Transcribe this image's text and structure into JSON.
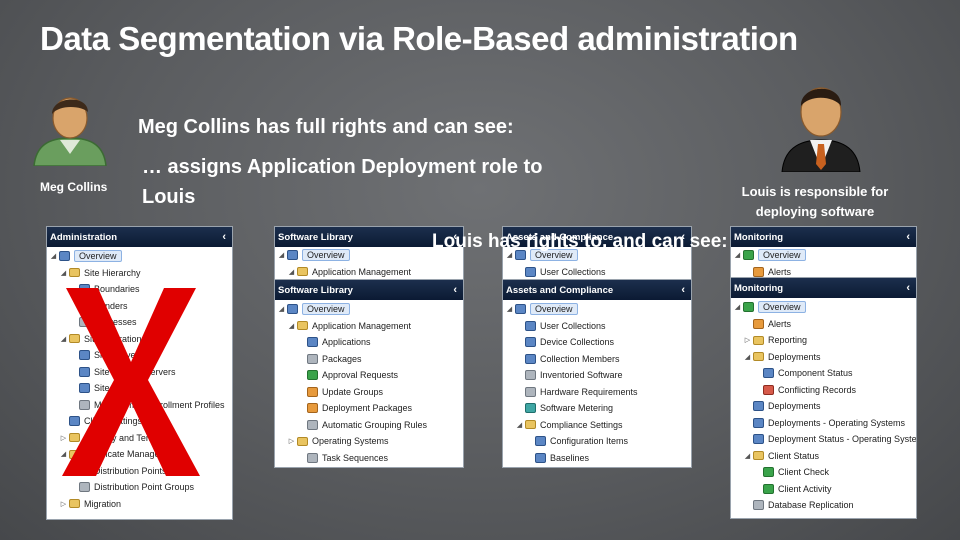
{
  "title": "Data Segmentation via Role-Based administration",
  "meg": {
    "caption": "Meg Collins",
    "line1": "Meg Collins has full rights and can see:",
    "line2": "… assigns Application Deployment role to Louis"
  },
  "louis": {
    "caption": "Louis is responsible for deploying software",
    "line3": "Louis has rights to, and can see:"
  },
  "colors": {
    "panel_header": "#0b1a33",
    "x_mark": "#e00000"
  },
  "admin_panel": {
    "header": "Administration",
    "items": [
      {
        "label": "Overview",
        "icon": "blue",
        "exp": "◢"
      },
      {
        "label": "Site Hierarchy",
        "icon": "folder",
        "exp": "◢"
      },
      {
        "label": "Boundaries",
        "icon": "blue",
        "exp": ""
      },
      {
        "label": "Senders",
        "icon": "gray",
        "exp": ""
      },
      {
        "label": "Addresses",
        "icon": "gray",
        "exp": ""
      },
      {
        "label": "Site Operations",
        "icon": "folder",
        "exp": "◢"
      },
      {
        "label": "Site Servers",
        "icon": "blue",
        "exp": ""
      },
      {
        "label": "Site System Servers",
        "icon": "blue",
        "exp": ""
      },
      {
        "label": "Site Roles",
        "icon": "blue",
        "exp": ""
      },
      {
        "label": "Management Enrollment Profiles",
        "icon": "gray",
        "exp": ""
      },
      {
        "label": "Client Settings",
        "icon": "blue",
        "exp": ""
      },
      {
        "label": "Security and Templates",
        "icon": "folder",
        "exp": "▷"
      },
      {
        "label": "Certificate Management",
        "icon": "folder",
        "exp": "◢"
      },
      {
        "label": "Distribution Points",
        "icon": "blue",
        "exp": ""
      },
      {
        "label": "Distribution Point Groups",
        "icon": "gray",
        "exp": ""
      },
      {
        "label": "Migration",
        "icon": "folder",
        "exp": "▷"
      }
    ]
  },
  "sw_panel_back": {
    "header": "Software Library",
    "items": [
      {
        "label": "Overview",
        "icon": "blue",
        "exp": "◢"
      },
      {
        "label": "Application Management",
        "icon": "folder",
        "exp": "◢"
      }
    ]
  },
  "sw_panel": {
    "header": "Software Library",
    "items": [
      {
        "label": "Overview",
        "icon": "blue",
        "exp": "◢"
      },
      {
        "label": "Application Management",
        "icon": "folder",
        "exp": "◢"
      },
      {
        "label": "Applications",
        "icon": "blue",
        "exp": ""
      },
      {
        "label": "Packages",
        "icon": "gray",
        "exp": ""
      },
      {
        "label": "Approval Requests",
        "icon": "green",
        "exp": ""
      },
      {
        "label": "Update Groups",
        "icon": "orange",
        "exp": ""
      },
      {
        "label": "Deployment Packages",
        "icon": "orange",
        "exp": ""
      },
      {
        "label": "Automatic Grouping Rules",
        "icon": "gray",
        "exp": ""
      },
      {
        "label": "Operating Systems",
        "icon": "folder",
        "exp": "▷"
      },
      {
        "label": "Task Sequences",
        "icon": "gray",
        "exp": ""
      }
    ]
  },
  "ac_panel_back": {
    "header": "Assets and Compliance",
    "items": [
      {
        "label": "Overview",
        "icon": "blue",
        "exp": "◢"
      },
      {
        "label": "User Collections",
        "icon": "blue",
        "exp": ""
      }
    ]
  },
  "ac_panel": {
    "header": "Assets and Compliance",
    "items": [
      {
        "label": "Overview",
        "icon": "blue",
        "exp": "◢"
      },
      {
        "label": "User Collections",
        "icon": "blue",
        "exp": ""
      },
      {
        "label": "Device Collections",
        "icon": "blue",
        "exp": ""
      },
      {
        "label": "Collection Members",
        "icon": "blue",
        "exp": ""
      },
      {
        "label": "Inventoried Software",
        "icon": "gray",
        "exp": ""
      },
      {
        "label": "Hardware Requirements",
        "icon": "gray",
        "exp": ""
      },
      {
        "label": "Software Metering",
        "icon": "teal",
        "exp": ""
      },
      {
        "label": "Compliance Settings",
        "icon": "folder",
        "exp": "◢"
      },
      {
        "label": "Configuration Items",
        "icon": "blue",
        "exp": ""
      },
      {
        "label": "Baselines",
        "icon": "blue",
        "exp": ""
      }
    ]
  },
  "mon_panel_back": {
    "header": "Monitoring",
    "items": [
      {
        "label": "Overview",
        "icon": "green",
        "exp": "◢"
      },
      {
        "label": "Alerts",
        "icon": "orange",
        "exp": ""
      }
    ]
  },
  "mon_panel": {
    "header": "Monitoring",
    "items": [
      {
        "label": "Overview",
        "icon": "green",
        "exp": "◢"
      },
      {
        "label": "Alerts",
        "icon": "orange",
        "exp": ""
      },
      {
        "label": "Reporting",
        "icon": "folder",
        "exp": "▷"
      },
      {
        "label": "Deployments",
        "icon": "folder",
        "exp": "◢"
      },
      {
        "label": "Component Status",
        "icon": "blue",
        "exp": ""
      },
      {
        "label": "Conflicting Records",
        "icon": "red",
        "exp": ""
      },
      {
        "label": "Deployments",
        "icon": "blue",
        "exp": ""
      },
      {
        "label": "Deployments - Operating Systems",
        "icon": "blue",
        "exp": ""
      },
      {
        "label": "Deployment Status - Operating Syste",
        "icon": "blue",
        "exp": ""
      },
      {
        "label": "Client Status",
        "icon": "folder",
        "exp": "◢"
      },
      {
        "label": "Client Check",
        "icon": "green",
        "exp": ""
      },
      {
        "label": "Client Activity",
        "icon": "green",
        "exp": ""
      },
      {
        "label": "Database Replication",
        "icon": "gray",
        "exp": ""
      }
    ]
  }
}
